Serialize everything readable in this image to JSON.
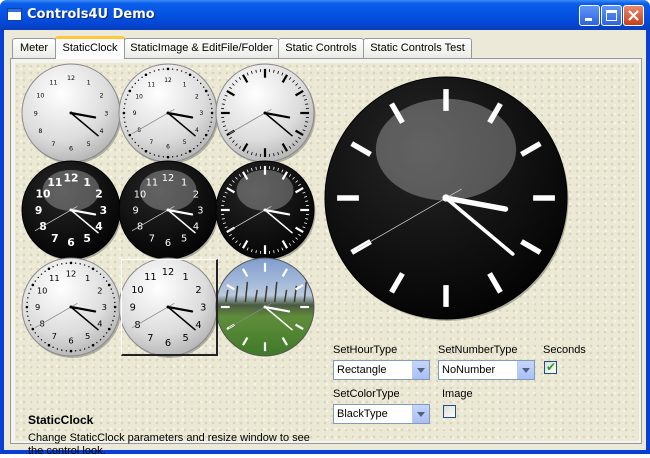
{
  "window": {
    "title": "Controls4U Demo"
  },
  "tabs": [
    {
      "label": "Meter",
      "active": false
    },
    {
      "label": "StaticClock",
      "active": true
    },
    {
      "label": "StaticImage & EditFile/Folder",
      "active": false
    },
    {
      "label": "Static Controls",
      "active": false
    },
    {
      "label": "Static Controls Test",
      "active": false
    }
  ],
  "clock_time": {
    "hour": 3,
    "minute": 21,
    "second": 40
  },
  "info": {
    "title": "StaticClock",
    "description": "Change StaticClock parameters and resize window to see the control look."
  },
  "options": {
    "hour_type": {
      "label": "SetHourType",
      "value": "Rectangle"
    },
    "number_type": {
      "label": "SetNumberType",
      "value": "NoNumber"
    },
    "seconds": {
      "label": "Seconds",
      "checked": true
    },
    "color_type": {
      "label": "SetColorType",
      "value": "BlackType"
    },
    "image": {
      "label": "Image",
      "checked": false
    }
  },
  "clock_numbers": [
    "12",
    "1",
    "2",
    "3",
    "4",
    "5",
    "6",
    "7",
    "8",
    "9",
    "10",
    "11"
  ],
  "colors": {
    "title_bar": "#0554e3",
    "tab_highlight": "#ffc83c",
    "check_green": "#21a121"
  }
}
